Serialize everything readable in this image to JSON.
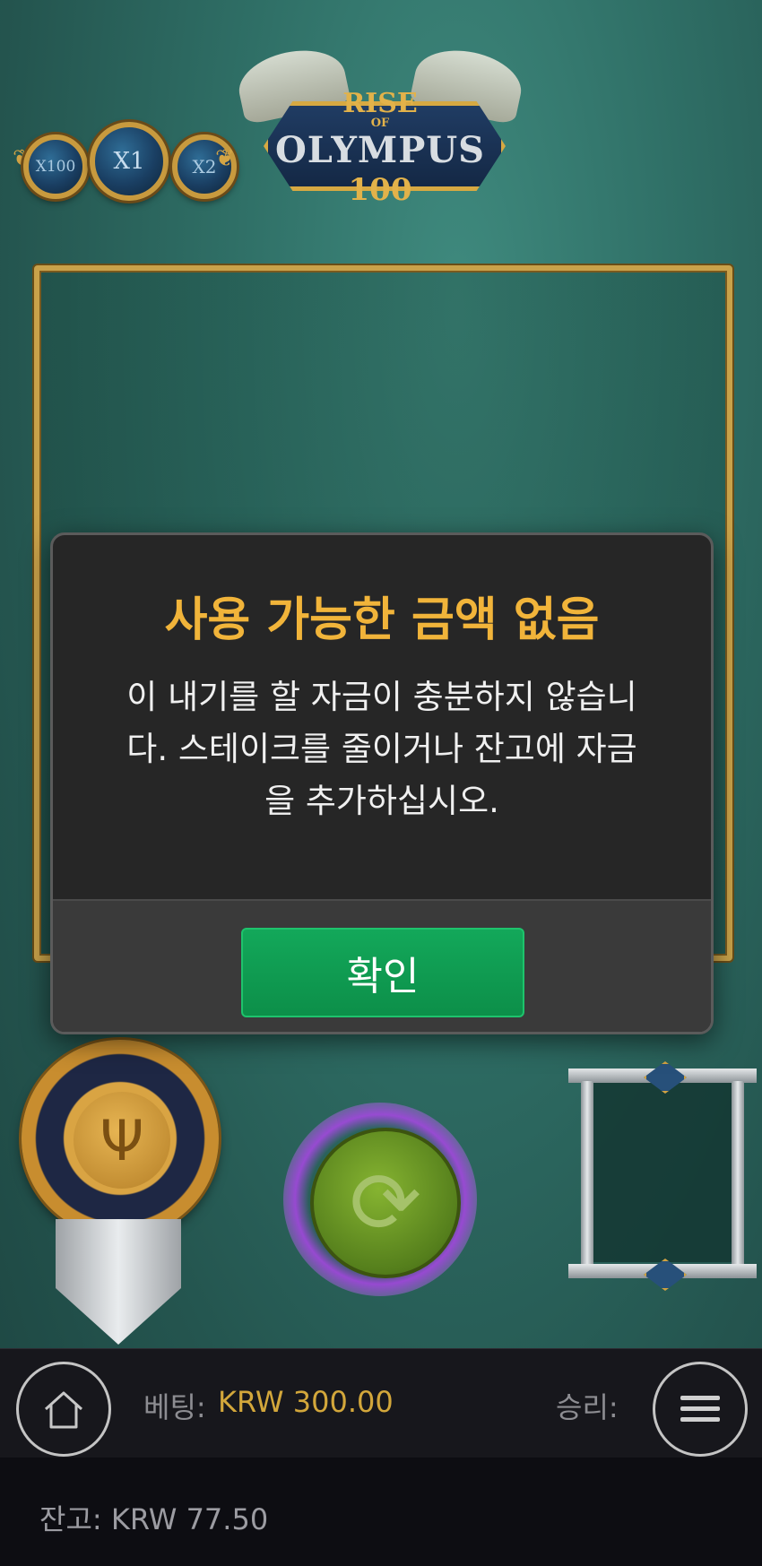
{
  "multipliers": [
    "X100",
    "X1",
    "X2"
  ],
  "logo": {
    "line1": "RISE",
    "line2": "OF",
    "line3": "OLYMPUS",
    "line4": "100"
  },
  "dialog": {
    "title": "사용 가능한 금액 없음",
    "message_lines": [
      "이 내기를 할 자금이 충분하지 않습니",
      "다. 스테이크를 줄이거나 잔고에 자금",
      "을 추가하십시오."
    ],
    "ok_label": "확인"
  },
  "bottom_bar": {
    "bet_label": "베팅:",
    "bet_value": "KRW 300.00",
    "win_label": "승리:"
  },
  "footer": {
    "balance": "잔고: KRW 77.50"
  },
  "colors": {
    "dialog_title": "#f1b43a",
    "ok_button": "#13a85a",
    "bet_value": "#d3a73b"
  },
  "icons": [
    "home-icon",
    "menu-icon",
    "spin-icon",
    "trident-icon"
  ]
}
